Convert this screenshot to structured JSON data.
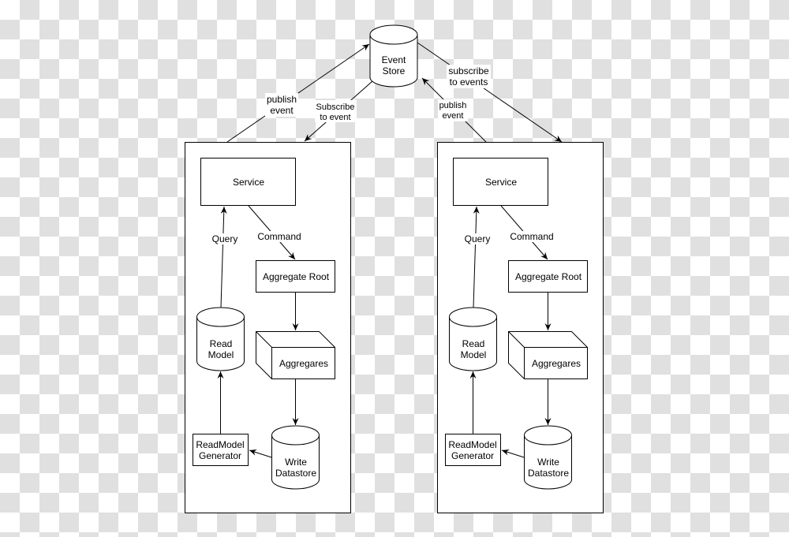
{
  "event_store": {
    "line1": "Event",
    "line2": "Store"
  },
  "edges": {
    "left_publish": {
      "line1": "publish",
      "line2": "event"
    },
    "left_subscribe": {
      "line1": "Subscribe",
      "line2": "to event"
    },
    "right_publish": {
      "line1": "publish",
      "line2": "event"
    },
    "right_subscribe": {
      "line1": "subscribe",
      "line2": "to events"
    }
  },
  "service": {
    "service": "Service",
    "command": "Command",
    "query": "Query",
    "aggregate_root": "Aggregate Root",
    "aggregates": "Aggregares",
    "read_model": {
      "line1": "Read",
      "line2": "Model"
    },
    "generator": {
      "line1": "ReadModel",
      "line2": "Generator"
    },
    "write_datastore": {
      "line1": "Write",
      "line2": "Datastore"
    }
  }
}
